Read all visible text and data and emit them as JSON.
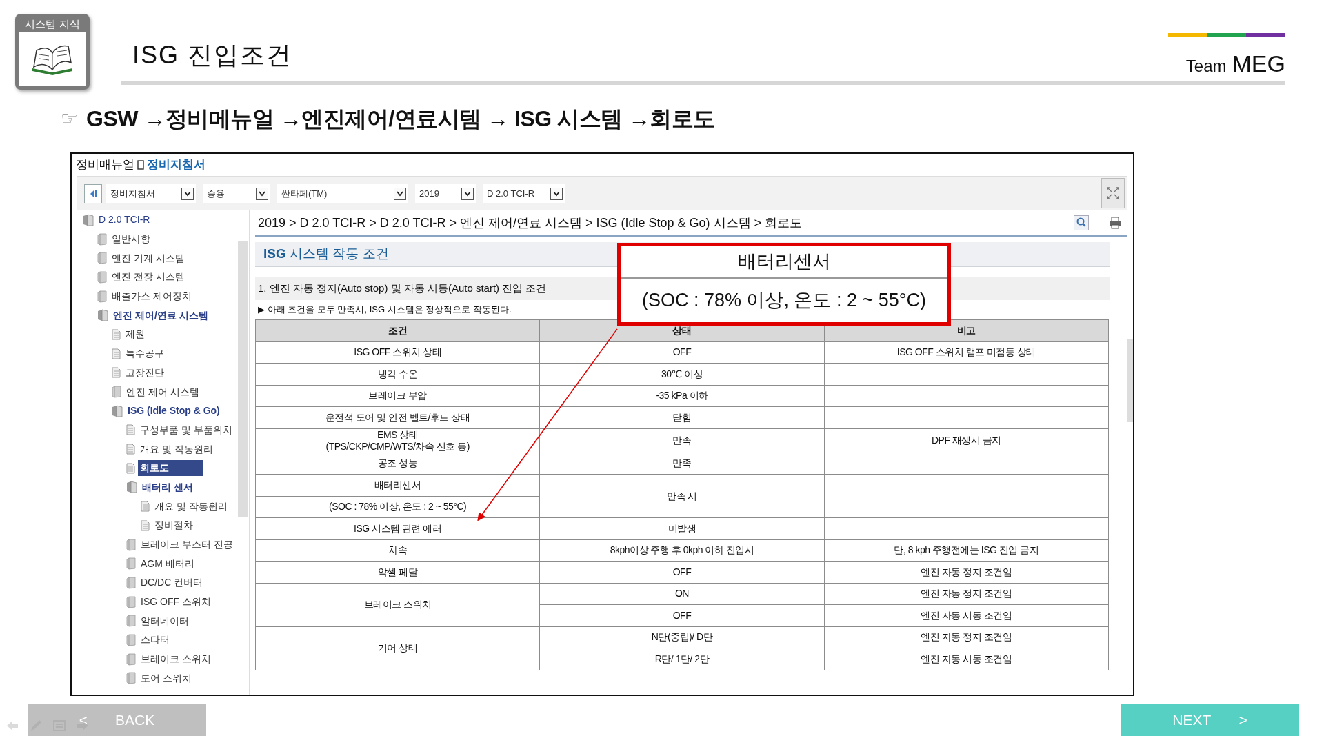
{
  "badge": {
    "label": "시스템 지식"
  },
  "title": "ISG 진입조건",
  "brand": {
    "prefix": "Team",
    "name": "MEG"
  },
  "path": {
    "pointer": "☞",
    "text": "GSW →정비메뉴얼 →엔진제어/연료시템 → ISG 시스템 →회로도"
  },
  "manual": {
    "section": "정비매뉴얼",
    "current": "정비지침서",
    "selects": [
      {
        "value": "정비지침서"
      },
      {
        "value": "승용"
      },
      {
        "value": "싼타페(TM)"
      },
      {
        "value": "2019"
      },
      {
        "value": "D 2.0 TCI-R"
      }
    ],
    "tree": [
      {
        "label": "D 2.0 TCI-R",
        "kind": "folder",
        "expanded": true,
        "selected": false,
        "children": [
          {
            "label": "일반사항",
            "kind": "folder",
            "expanded": false,
            "selected": false
          },
          {
            "label": "엔진 기계 시스템",
            "kind": "folder",
            "expanded": false,
            "selected": false
          },
          {
            "label": "엔진 전장 시스템",
            "kind": "folder",
            "expanded": false,
            "selected": false
          },
          {
            "label": "배출가스 제어장치",
            "kind": "folder",
            "expanded": false,
            "selected": false
          },
          {
            "label": "엔진 제어/연료 시스템",
            "kind": "folder",
            "expanded": true,
            "selected": false,
            "children": [
              {
                "label": "제원",
                "kind": "page",
                "selected": false
              },
              {
                "label": "특수공구",
                "kind": "page",
                "selected": false
              },
              {
                "label": "고장진단",
                "kind": "page",
                "selected": false
              },
              {
                "label": "엔진 제어 시스템",
                "kind": "folder",
                "expanded": false,
                "selected": false
              },
              {
                "label": "ISG (Idle Stop & Go)",
                "kind": "folder",
                "expanded": true,
                "selected": false,
                "children": [
                  {
                    "label": "구성부품 및 부품위치",
                    "kind": "page",
                    "selected": false
                  },
                  {
                    "label": "개요 및 작동원리",
                    "kind": "page",
                    "selected": false
                  },
                  {
                    "label": "회로도",
                    "kind": "page",
                    "selected": true
                  },
                  {
                    "label": "배터리 센서",
                    "kind": "folder",
                    "expanded": true,
                    "selected": false,
                    "children": [
                      {
                        "label": "개요 및 작동원리",
                        "kind": "page",
                        "selected": false
                      },
                      {
                        "label": "정비절차",
                        "kind": "page",
                        "selected": false
                      }
                    ]
                  },
                  {
                    "label": "브레이크 부스터 진공",
                    "kind": "folder",
                    "expanded": false,
                    "selected": false
                  },
                  {
                    "label": "AGM 배터리",
                    "kind": "folder",
                    "expanded": false,
                    "selected": false
                  },
                  {
                    "label": "DC/DC 컨버터",
                    "kind": "folder",
                    "expanded": false,
                    "selected": false
                  },
                  {
                    "label": "ISG OFF 스위치",
                    "kind": "folder",
                    "expanded": false,
                    "selected": false
                  },
                  {
                    "label": "알터네이터",
                    "kind": "folder",
                    "expanded": false,
                    "selected": false
                  },
                  {
                    "label": "스타터",
                    "kind": "folder",
                    "expanded": false,
                    "selected": false
                  },
                  {
                    "label": "브레이크 스위치",
                    "kind": "folder",
                    "expanded": false,
                    "selected": false
                  },
                  {
                    "label": "도어 스위치",
                    "kind": "folder",
                    "expanded": false,
                    "selected": false
                  }
                ]
              }
            ]
          }
        ]
      }
    ],
    "breadcrumb": "2019 > D 2.0 TCI-R > D 2.0 TCI-R > 엔진 제어/연료 시스템 > ISG (Idle Stop & Go) 시스템 > 회로도",
    "heading": "**ISG** 시스템 작동 조건",
    "subheading": "1. 엔진 자동 정지(Auto stop) 및 자동 시동(Auto start) 진입 조건",
    "note": "▶ 아래 조건을 모두 만족시, ISG 시스템은 정상적으로 작동된다.",
    "table": {
      "columns": [
        "조건",
        "상태",
        "비고"
      ],
      "rows": [
        {
          "conditions": [
            "ISG OFF 스위치 상태"
          ],
          "entries": [
            {
              "state": "OFF",
              "note": "ISG OFF 스위치 램프 미점등 상태"
            }
          ]
        },
        {
          "conditions": [
            "냉각 수온"
          ],
          "entries": [
            {
              "state": "30℃ 이상"
            }
          ]
        },
        {
          "conditions": [
            "브레이크 부압"
          ],
          "entries": [
            {
              "state": "-35 kPa 이하"
            }
          ]
        },
        {
          "conditions": [
            "운전석 도어 및 안전 벨트/후드 상태"
          ],
          "entries": [
            {
              "state": "닫힘"
            }
          ]
        },
        {
          "conditions": [
            "EMS 상태\n(TPS/CKP/CMP/WTS/차속 신호 등)"
          ],
          "entries": [
            {
              "state": "만족",
              "note": "DPF 재생시 금지"
            }
          ]
        },
        {
          "conditions": [
            "공조 성능"
          ],
          "entries": [
            {
              "state": "만족"
            }
          ]
        },
        {
          "conditions": [
            "배터리센서",
            "(SOC : 78% 이상, 온도 : 2 ~ 55°C)"
          ],
          "entries": [
            {
              "state": "만족 시"
            }
          ]
        },
        {
          "conditions": [
            "ISG 시스템 관련 에러"
          ],
          "entries": [
            {
              "state": "미발생"
            }
          ]
        },
        {
          "conditions": [
            "차속"
          ],
          "entries": [
            {
              "state": "8kph이상 주행 후 0kph 이하 진입시",
              "note": "단, 8 kph 주행전에는 ISG 진입 금지"
            }
          ]
        },
        {
          "conditions": [
            "악셀 페달"
          ],
          "entries": [
            {
              "state": "OFF",
              "note": "엔진 자동 정지 조건임"
            }
          ]
        },
        {
          "conditions": [
            "브레이크 스위치"
          ],
          "entries": [
            {
              "state": "ON",
              "note": "엔진 자동 정지 조건임"
            },
            {
              "state": "OFF",
              "note": "엔진 자동 시동 조건임"
            }
          ]
        },
        {
          "conditions": [
            "기어 상태"
          ],
          "entries": [
            {
              "state": "N단(중립)/ D단",
              "note": "엔진 자동 정지 조건임"
            },
            {
              "state": "R단/ 1단/ 2단",
              "note": "엔진 자동 시동 조건임"
            }
          ]
        }
      ]
    }
  },
  "callout": {
    "title": "배터리센서",
    "detail": "(SOC : 78% 이상, 온도 : 2 ~ 55°C)"
  },
  "nav": [
    {
      "kind": "back",
      "arrow": "<",
      "label": "BACK",
      "disabled": true
    },
    {
      "kind": "next",
      "label": "NEXT",
      "arrow": ">",
      "disabled": false
    }
  ]
}
